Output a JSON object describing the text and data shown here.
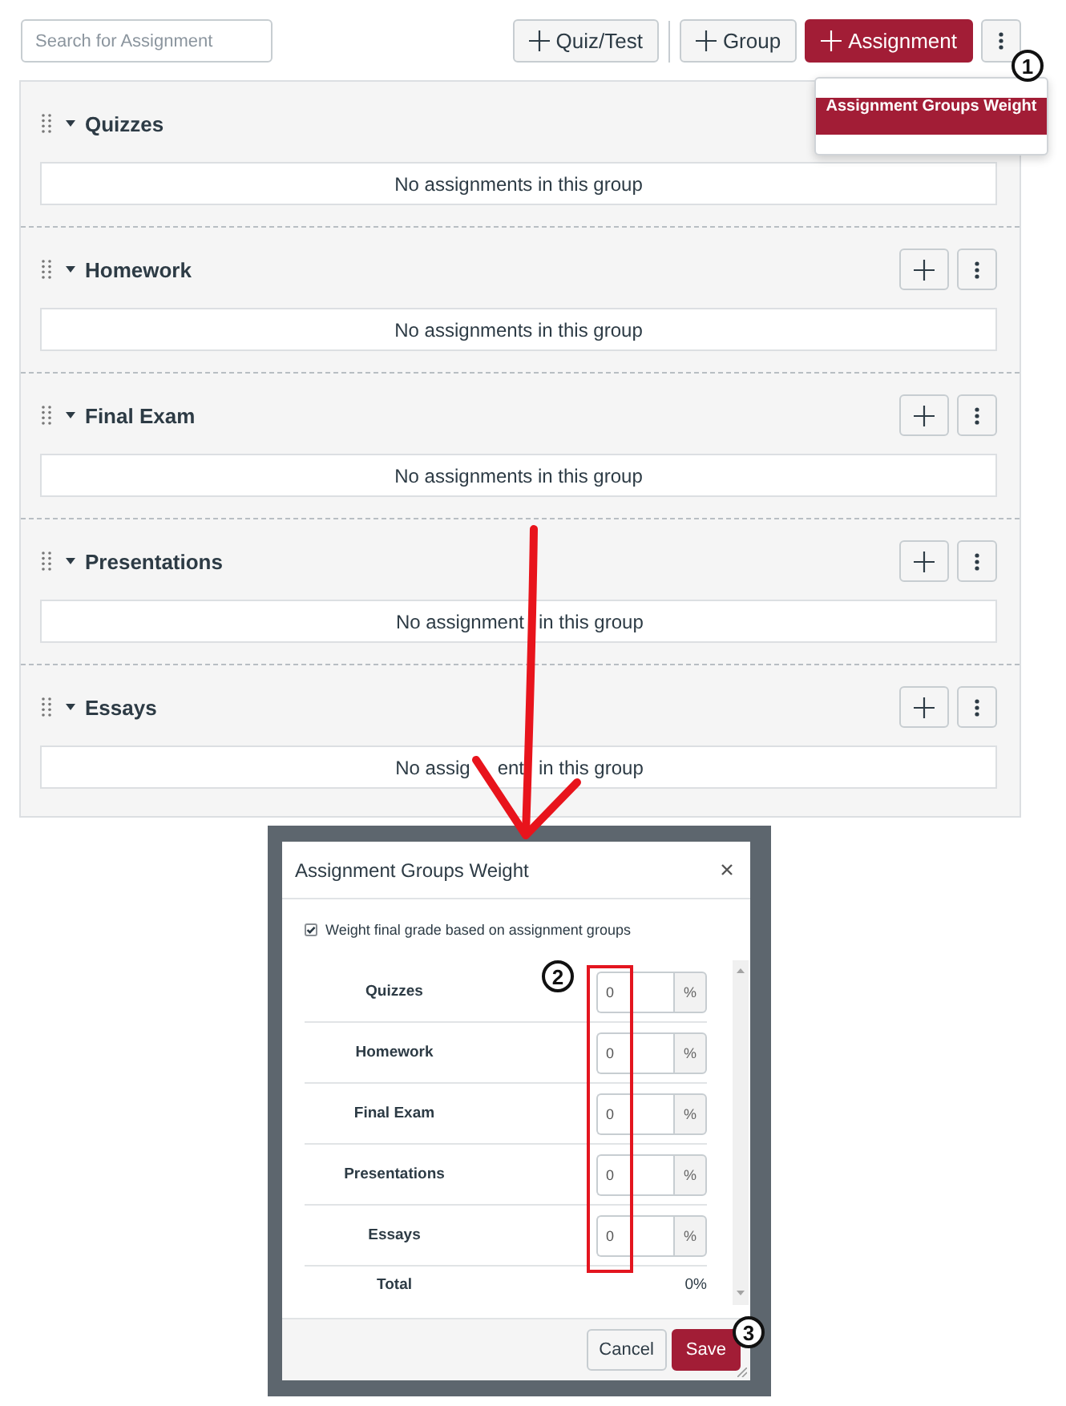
{
  "toolbar": {
    "search": {
      "placeholder": "Search for Assignment"
    },
    "button_groups": [
      [
        {
          "label": "Quiz/Test",
          "kind": "secondary"
        }
      ],
      [
        {
          "label": "Group",
          "kind": "secondary"
        },
        {
          "label": "Assignment",
          "kind": "primary"
        }
      ]
    ]
  },
  "menu": {
    "open": true,
    "items": [
      {
        "label": "Assignment Groups Weight",
        "selected": true
      }
    ]
  },
  "groups": [
    {
      "title": "Quizzes",
      "expanded": true,
      "empty_message": [
        "No assignments in this group"
      ]
    },
    {
      "title": "Homework",
      "expanded": true,
      "actions": [
        {
          "kind": "add"
        },
        {
          "kind": "more"
        }
      ],
      "empty_message": [
        "No assignments in this group"
      ]
    },
    {
      "title": "Final Exam",
      "expanded": true,
      "actions": [
        {
          "kind": "add"
        },
        {
          "kind": "more"
        }
      ],
      "empty_message": [
        "No assignments in this group"
      ]
    },
    {
      "title": "Presentations",
      "expanded": true,
      "actions": [
        {
          "kind": "add"
        },
        {
          "kind": "more"
        }
      ],
      "empty_message": [
        "No assignment",
        "in this group"
      ]
    },
    {
      "title": "Essays",
      "expanded": true,
      "actions": [
        {
          "kind": "add"
        },
        {
          "kind": "more"
        }
      ],
      "empty_message": [
        "No assig",
        "ent",
        "in this group"
      ]
    }
  ],
  "dialog": {
    "title": "Assignment Groups Weight",
    "weight_checkbox": {
      "label": "Weight final grade based on assignment groups",
      "checked": true
    },
    "rows": [
      {
        "name": "Quizzes",
        "value": "0",
        "unit": "%"
      },
      {
        "name": "Homework",
        "value": "0",
        "unit": "%"
      },
      {
        "name": "Final Exam",
        "value": "0",
        "unit": "%"
      },
      {
        "name": "Presentations",
        "value": "0",
        "unit": "%"
      },
      {
        "name": "Essays",
        "value": "0",
        "unit": "%"
      }
    ],
    "total": {
      "label": "Total",
      "value": "0%"
    },
    "buttons": [
      {
        "label": "Cancel",
        "kind": "secondary"
      },
      {
        "label": "Save",
        "kind": "primary"
      }
    ]
  },
  "callouts": [
    "1",
    "2",
    "3"
  ]
}
